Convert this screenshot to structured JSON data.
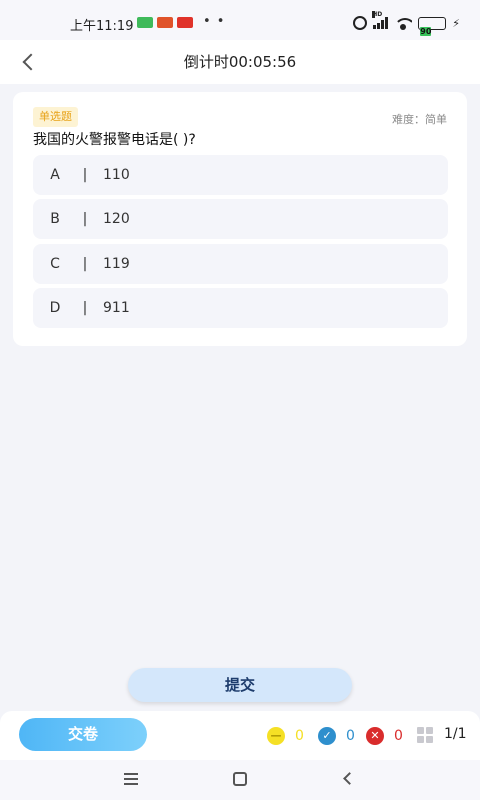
{
  "status_bar": {
    "time": "上午11:19",
    "battery": "90",
    "hd": "HD",
    "dots": "• •",
    "bolt": "⚡"
  },
  "header": {
    "title": "倒计时00:05:56"
  },
  "question": {
    "type": "单选题",
    "difficulty": "难度：简单",
    "text": "我国的火警报警电话是( )?",
    "separator": "|",
    "options": [
      {
        "letter": "A",
        "text": "110"
      },
      {
        "letter": "B",
        "text": "120"
      },
      {
        "letter": "C",
        "text": "119"
      },
      {
        "letter": "D",
        "text": "911"
      }
    ]
  },
  "submit": {
    "label": "提交"
  },
  "bottom_bar": {
    "handin_label": "交卷",
    "unanswered": {
      "count": "0",
      "symbol": "—",
      "color": "#f5e025"
    },
    "correct": {
      "count": "0",
      "symbol": "✓",
      "color": "#2e8fcd"
    },
    "wrong": {
      "count": "0",
      "symbol": "✕",
      "color": "#d92c2c"
    },
    "progress": "1/1"
  },
  "colors": {
    "accent": "#4fb6f6",
    "tag_bg": "#fdf3d3",
    "tag_text": "#e8a31a"
  }
}
